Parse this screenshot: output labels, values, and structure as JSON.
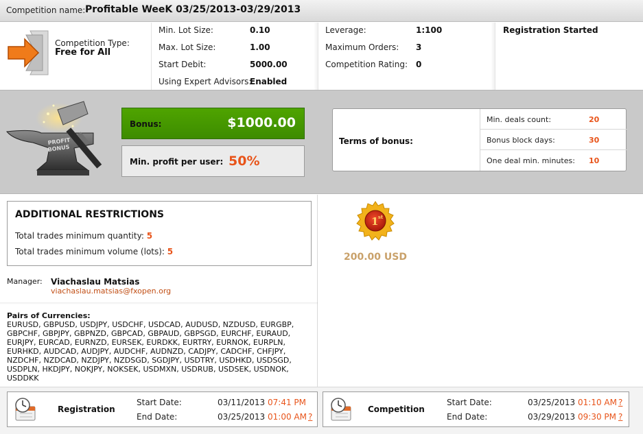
{
  "header": {
    "label": "Competition name:",
    "name": "Profitable WeeK 03/25/2013-03/29/2013"
  },
  "competition_type": {
    "label": "Competition Type:",
    "value": "Free for All",
    "icon": "arrow-right-icon"
  },
  "params_col1": [
    {
      "label": "Min. Lot Size:",
      "value": "0.10"
    },
    {
      "label": "Max. Lot Size:",
      "value": "1.00"
    },
    {
      "label": "Start Debit:",
      "value": "5000.00"
    },
    {
      "label": "Using Expert Advisors:",
      "value": "Enabled"
    }
  ],
  "params_col2": [
    {
      "label": "Leverage:",
      "value": "1:100"
    },
    {
      "label": "Maximum Orders:",
      "value": "3"
    },
    {
      "label": "Competition Rating:",
      "value": "0"
    }
  ],
  "status": "Registration Started",
  "bonus": {
    "label": "Bonus:",
    "value": "$1000.00",
    "min_profit_label": "Min. profit per user:",
    "min_profit_value": "50%",
    "image_text": "PROFIT BONUS",
    "terms_label": "Terms of bonus:",
    "terms": [
      {
        "label": "Min. deals count:",
        "value": "20"
      },
      {
        "label": "Bonus block days:",
        "value": "30"
      },
      {
        "label": "One deal min. minutes:",
        "value": "10"
      }
    ]
  },
  "restrictions": {
    "title": "ADDITIONAL RESTRICTIONS",
    "items": [
      {
        "label": "Total trades minimum quantity:",
        "value": "5"
      },
      {
        "label": "Total trades minimum volume (lots):",
        "value": "5"
      }
    ]
  },
  "manager": {
    "label": "Manager:",
    "name": "Viachaslau Matsias",
    "email": "viachaslau.matsias@fxopen.org"
  },
  "pairs": {
    "label": "Pairs of Currencies:",
    "list": "EURUSD, GBPUSD, USDJPY, USDCHF, USDCAD, AUDUSD, NZDUSD, EURGBP, GBPCHF, GBPJPY, GBPNZD, GBPCAD, GBPAUD, GBPSGD, EURCHF, EURAUD, EURJPY, EURCAD, EURNZD, EURSEK, EURDKK, EURTRY, EURNOK, EURPLN, EURHKD, AUDCAD, AUDJPY, AUDCHF, AUDNZD, CADJPY, CADCHF, CHFJPY, NZDCHF, NZDCAD, NZDJPY, NZDSGD, SGDJPY, USDTRY, USDHKD, USDSGD, USDPLN, HKDJPY, NOKJPY, NOKSEK, USDMXN, USDRUB, USDSEK, USDNOK, USDDKK"
  },
  "prize": {
    "place": "1",
    "place_suffix": "st",
    "amount": "200.00 USD",
    "icon": "first-place-medal-icon"
  },
  "registration": {
    "title": "Registration",
    "start_label": "Start Date:",
    "start_date": "03/11/2013",
    "start_time": "07:41 PM",
    "end_label": "End Date:",
    "end_date": "03/25/2013",
    "end_time": "01:00 AM",
    "help": "?"
  },
  "competition": {
    "title": "Competition",
    "start_label": "Start Date:",
    "start_date": "03/25/2013",
    "start_time": "01:10 AM",
    "end_label": "End Date:",
    "end_date": "03/29/2013",
    "end_time": "09:30 PM",
    "help": "?"
  },
  "colors": {
    "accent_orange": "#e8541a",
    "bonus_green": "#4fa400",
    "prize_gold": "#c9a16a"
  }
}
